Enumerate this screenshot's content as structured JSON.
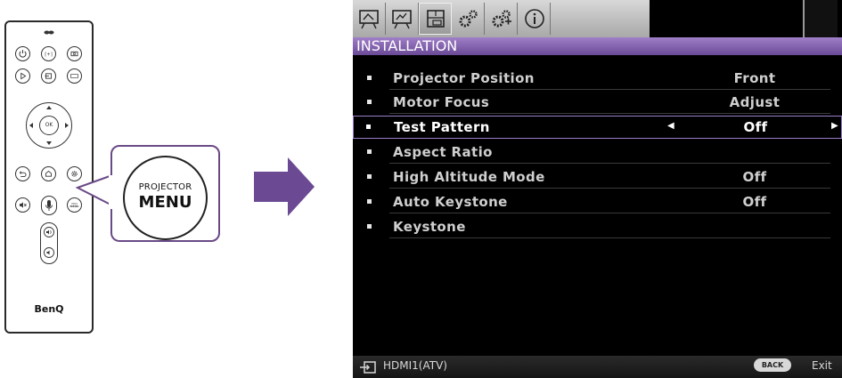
{
  "remote": {
    "brand": "BenQ",
    "ok_label": "OK",
    "menu_button_label": "PROJECTOR MENU"
  },
  "callout": {
    "line1": "PROJECTOR",
    "line2": "MENU"
  },
  "osd": {
    "tabs": [
      {
        "icon": "picture-icon"
      },
      {
        "icon": "display-icon"
      },
      {
        "icon": "installation-icon",
        "active": true
      },
      {
        "icon": "system-settings-basic-icon"
      },
      {
        "icon": "system-settings-advanced-icon"
      },
      {
        "icon": "information-icon"
      }
    ],
    "section_title": "INSTALLATION",
    "items": [
      {
        "label": "Projector Position",
        "value": "Front"
      },
      {
        "label": "Motor Focus",
        "value": "Adjust"
      },
      {
        "label": "Test Pattern",
        "value": "Off",
        "selected": true
      },
      {
        "label": "Aspect Ratio",
        "value": ""
      },
      {
        "label": "High Altitude Mode",
        "value": "Off"
      },
      {
        "label": "Auto Keystone",
        "value": "Off"
      },
      {
        "label": "Keystone",
        "value": ""
      }
    ],
    "footer": {
      "source": "HDMI1(ATV)",
      "back_label": "BACK",
      "exit_label": "Exit"
    },
    "colors": {
      "accent": "#7b59a8",
      "background": "#000000"
    }
  }
}
